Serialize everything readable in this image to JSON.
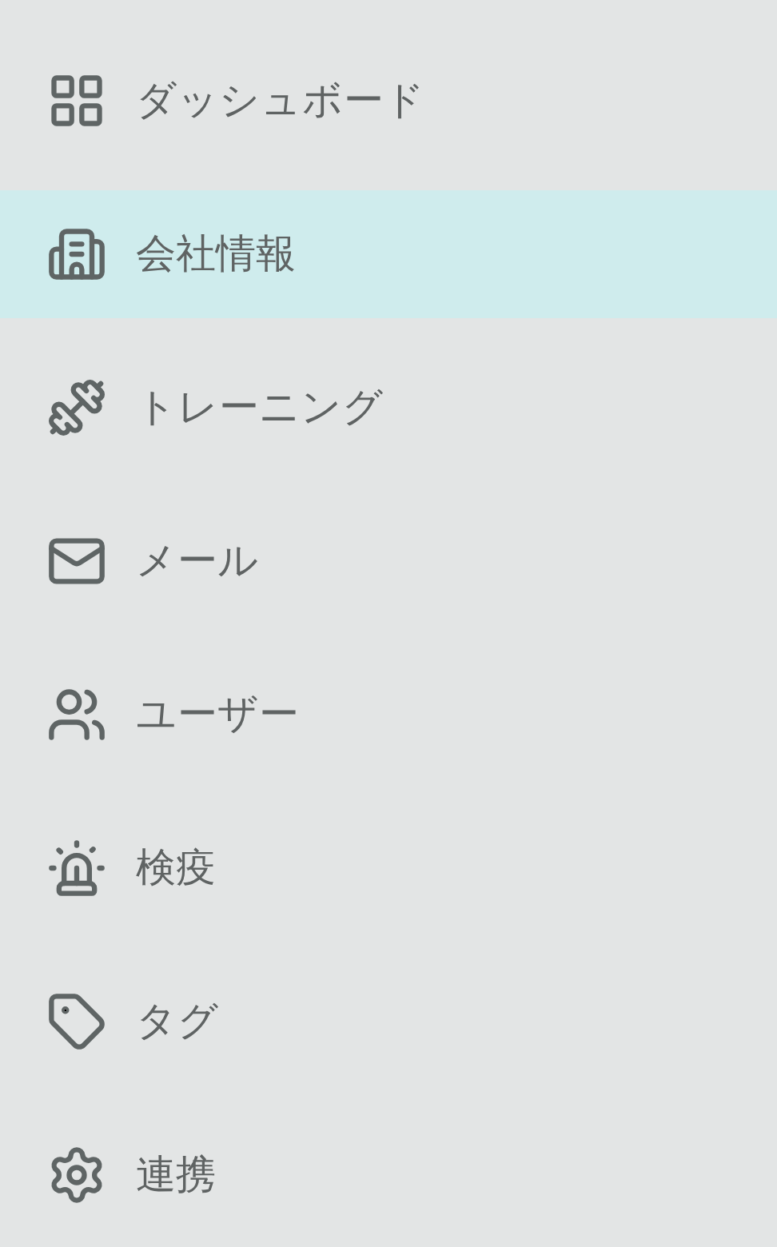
{
  "nav": {
    "items": [
      {
        "label": "ダッシュボード",
        "selected": false
      },
      {
        "label": "会社情報",
        "selected": true
      },
      {
        "label": "トレーニング",
        "selected": false
      },
      {
        "label": "メール",
        "selected": false
      },
      {
        "label": "ユーザー",
        "selected": false
      },
      {
        "label": "検疫",
        "selected": false
      },
      {
        "label": "タグ",
        "selected": false
      },
      {
        "label": "連携",
        "selected": false
      }
    ]
  }
}
